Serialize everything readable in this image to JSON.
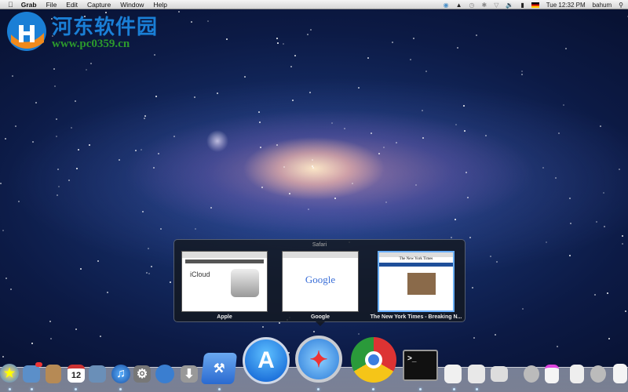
{
  "menubar": {
    "app": "Grab",
    "items": [
      "File",
      "Edit",
      "Capture",
      "Window",
      "Help"
    ],
    "clock": "Tue 12:32 PM",
    "user": "bahum"
  },
  "watermark": {
    "name": "河东软件园",
    "url": "www.pc0359.cn"
  },
  "expose": {
    "title": "Safari",
    "windows": [
      {
        "label": "Apple",
        "heading": "iCloud"
      },
      {
        "label": "Google",
        "heading": "Google"
      },
      {
        "label": "The New York Times - Breaking N...",
        "heading": "The New York Times"
      }
    ]
  },
  "dock": {
    "calendar_day": "12",
    "terminal_prompt": ">_",
    "items": [
      "Finder",
      "Mail",
      "Address Book",
      "iCal",
      "iPhoto",
      "iTunes",
      "System Preferences",
      "Directory Utility",
      "Installer",
      "Xcode",
      "App Store",
      "Safari",
      "Chrome",
      "Terminal",
      "TextEdit",
      "Preview",
      "Archive",
      "Downloads",
      "Documents",
      "Stack",
      "Applications",
      "Trash"
    ]
  }
}
